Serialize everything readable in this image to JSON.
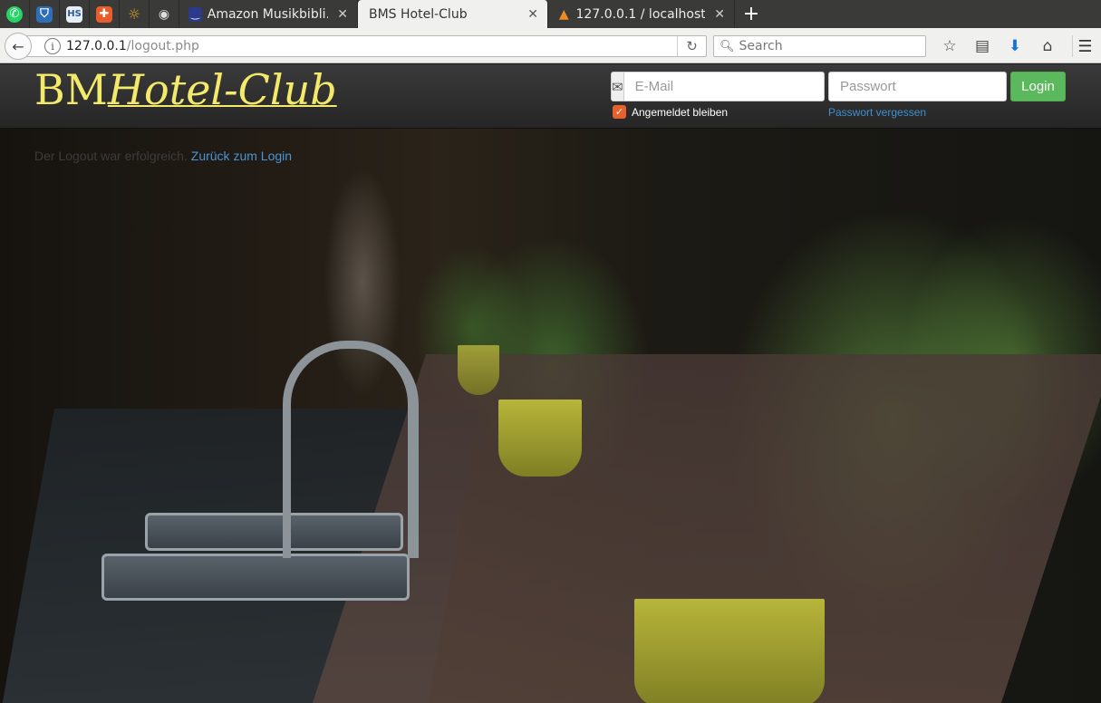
{
  "browser": {
    "pinned_tabs": [
      {
        "icon": "whatsapp-icon",
        "glyph": "✆",
        "color": "#25d366"
      },
      {
        "icon": "shield-icon",
        "glyph": "⛉",
        "color": "#2f6fb7"
      },
      {
        "icon": "hs-logo-icon",
        "glyph": "HS",
        "color": "#6fa0d8"
      },
      {
        "icon": "plus-cross-icon",
        "glyph": "✚",
        "color": "#e85d2a"
      },
      {
        "icon": "lightbulb-icon",
        "glyph": "☼",
        "color": "#e0a72a"
      },
      {
        "icon": "github-icon",
        "glyph": "◉",
        "color": "#cccccc"
      }
    ],
    "tabs": [
      {
        "title": "Amazon Musikbibli…",
        "icon": "amazon-music-icon",
        "active": false
      },
      {
        "title": "BMS Hotel-Club",
        "icon": "",
        "active": true
      },
      {
        "title": "127.0.0.1 / localhost…",
        "icon": "phpmyadmin-icon",
        "active": false
      }
    ],
    "url_host": "127.0.0.1",
    "url_path": "/logout.php",
    "search_placeholder": "Search"
  },
  "header": {
    "brand_plain": "BM",
    "brand_italic": "Hotel-Club",
    "email_placeholder": "E-Mail",
    "password_placeholder": "Passwort",
    "login_label": "Login",
    "remember_label": "Angemeldet bleiben",
    "remember_checked": true,
    "forgot_label": "Passwort vergessen"
  },
  "main": {
    "message": "Der Logout war erfolgreich.",
    "back_link": "Zurück zum Login"
  },
  "colors": {
    "brand": "#f3e96a",
    "login_button": "#5cb85c",
    "checkbox": "#e8612c",
    "link": "#4a95d6"
  }
}
